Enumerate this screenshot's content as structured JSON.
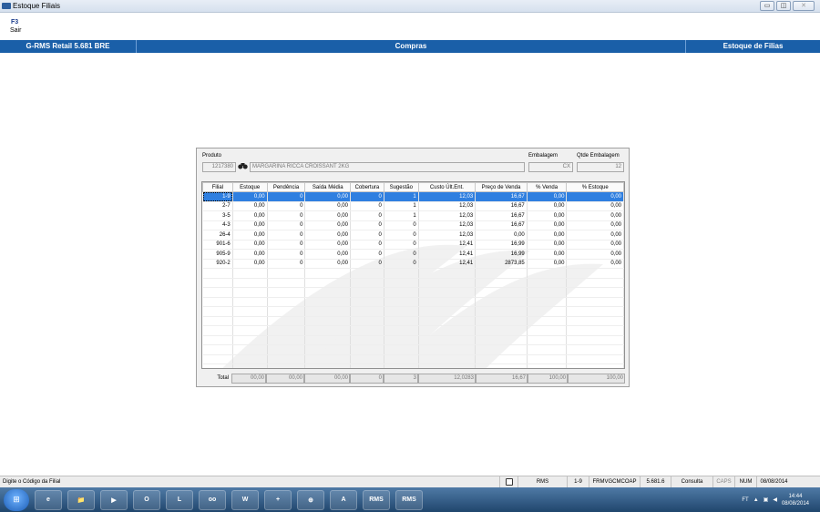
{
  "window": {
    "title": "Estoque Filiais",
    "minimize": "▭",
    "maximize": "◫",
    "close": "✕"
  },
  "fkeys": [
    {
      "key": "F3",
      "label": "Sair"
    }
  ],
  "header": {
    "left": "G-RMS Retail 5.681 BRE",
    "center": "Compras",
    "right": "Estoque de Filias"
  },
  "form": {
    "produto_label": "Produto",
    "produto_code": "1217380",
    "produto_desc": "MARGARINA RICCA CROISSANT 2KG",
    "embalagem_label": "Embalagem",
    "embalagem_value": "CX",
    "qtde_label": "Qtde Embalagem",
    "qtde_value": "12"
  },
  "table": {
    "columns": [
      "Filial",
      "Estoque",
      "Pendência",
      "Saída Média",
      "Cobertura",
      "Sugestão",
      "Custo Últ.Ent.",
      "Preço de Venda",
      "% Venda",
      "% Estoque"
    ],
    "rows": [
      [
        "1-9",
        "0,00",
        "0",
        "0,00",
        "0",
        "1",
        "12,03",
        "16,67",
        "0,00",
        "0,00"
      ],
      [
        "2-7",
        "0,00",
        "0",
        "0,00",
        "0",
        "1",
        "12,03",
        "16,67",
        "0,00",
        "0,00"
      ],
      [
        "3-5",
        "0,00",
        "0",
        "0,00",
        "0",
        "1",
        "12,03",
        "16,67",
        "0,00",
        "0,00"
      ],
      [
        "4-3",
        "0,00",
        "0",
        "0,00",
        "0",
        "0",
        "12,03",
        "16,67",
        "0,00",
        "0,00"
      ],
      [
        "26-4",
        "0,00",
        "0",
        "0,00",
        "0",
        "0",
        "12,03",
        "0,00",
        "0,00",
        "0,00"
      ],
      [
        "901-6",
        "0,00",
        "0",
        "0,00",
        "0",
        "0",
        "12,41",
        "16,99",
        "0,00",
        "0,00"
      ],
      [
        "905-9",
        "0,00",
        "0",
        "0,00",
        "0",
        "0",
        "12,41",
        "16,99",
        "0,00",
        "0,00"
      ],
      [
        "920-2",
        "0,00",
        "0",
        "0,00",
        "0",
        "0",
        "12,41",
        "2873,85",
        "0,00",
        "0,00"
      ]
    ],
    "selected_row": 0
  },
  "totals": {
    "label": "Total",
    "values": [
      "00,00",
      "00,00",
      "00,00",
      "0",
      "3",
      "12,0283",
      "16,67",
      "100,00",
      "100,00"
    ]
  },
  "status": {
    "message": "Digite o Código da Filial",
    "system": "RMS",
    "filial": "1-9",
    "program": "FRMVGCMCOAP",
    "version": "5.681.6",
    "mode": "Consulta",
    "caps": "CAPS",
    "num": "NUM",
    "date": "08/08/2014"
  },
  "taskbar": {
    "apps": [
      "e",
      "📁",
      "▶",
      "O",
      "L",
      "oo",
      "W",
      "+",
      "⊕",
      "A",
      "RMS",
      "RMS"
    ],
    "tray_label": "FT",
    "time": "14:44",
    "date": "08/08/2014"
  },
  "colors": {
    "header_bg": "#1a5fa8",
    "selection": "#2f7fe0"
  }
}
